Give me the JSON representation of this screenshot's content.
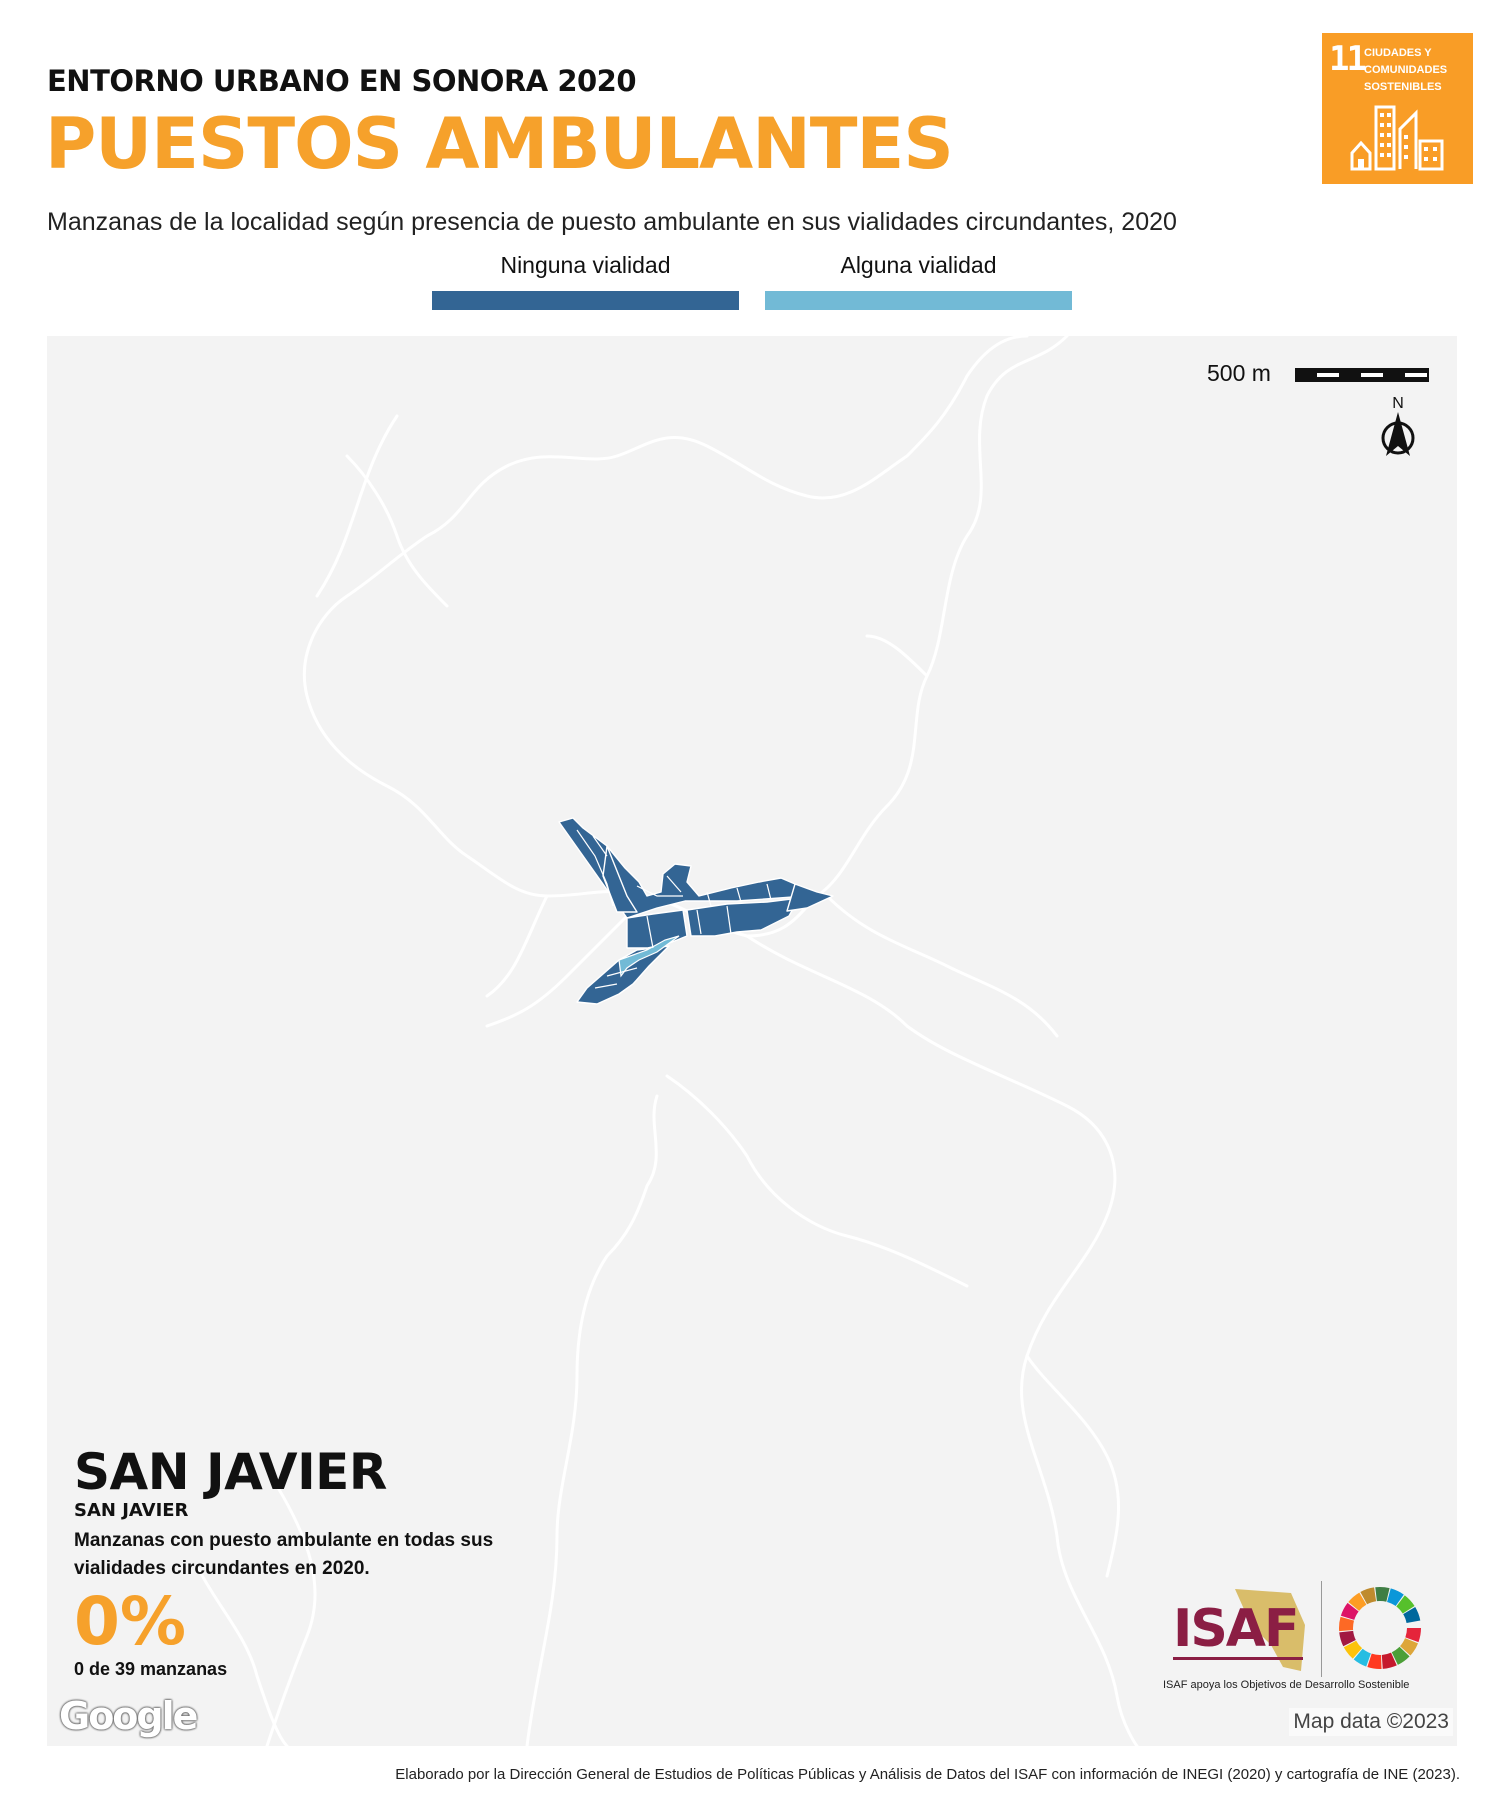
{
  "header": {
    "kicker": "ENTORNO URBANO EN SONORA 2020",
    "title": "PUESTOS AMBULANTES",
    "subtitle": "Manzanas de la localidad según presencia de puesto ambulante en sus vialidades circundantes, 2020"
  },
  "sdg_badge": {
    "number": "11",
    "lines": [
      "CIUDADES Y",
      "COMUNIDADES",
      "SOSTENIBLES"
    ],
    "color": "#f99d26"
  },
  "legend": [
    {
      "label": "Ninguna vialidad",
      "color": "#336594"
    },
    {
      "label": "Alguna vialidad",
      "color": "#72bad6"
    }
  ],
  "map": {
    "scale_label": "500 m",
    "north_label": "N",
    "background": "#f3f3f3",
    "google_logo": "Google",
    "attribution": "Map data ©2023"
  },
  "locality": {
    "name": "SAN JAVIER",
    "municipality": "SAN JAVIER",
    "description": "Manzanas con puesto ambulante en todas sus vialidades circundantes en 2020.",
    "percent": "0%",
    "count": "0 de 39 manzanas"
  },
  "logos": {
    "isaf": "ISAF",
    "caption": "ISAF apoya los Objetivos de Desarrollo Sostenible"
  },
  "footer": {
    "credit": "Elaborado por la Dirección General de Estudios de Políticas Públicas y Análisis de Datos del ISAF con información de INEGI (2020) y cartografía de INE (2023)."
  }
}
